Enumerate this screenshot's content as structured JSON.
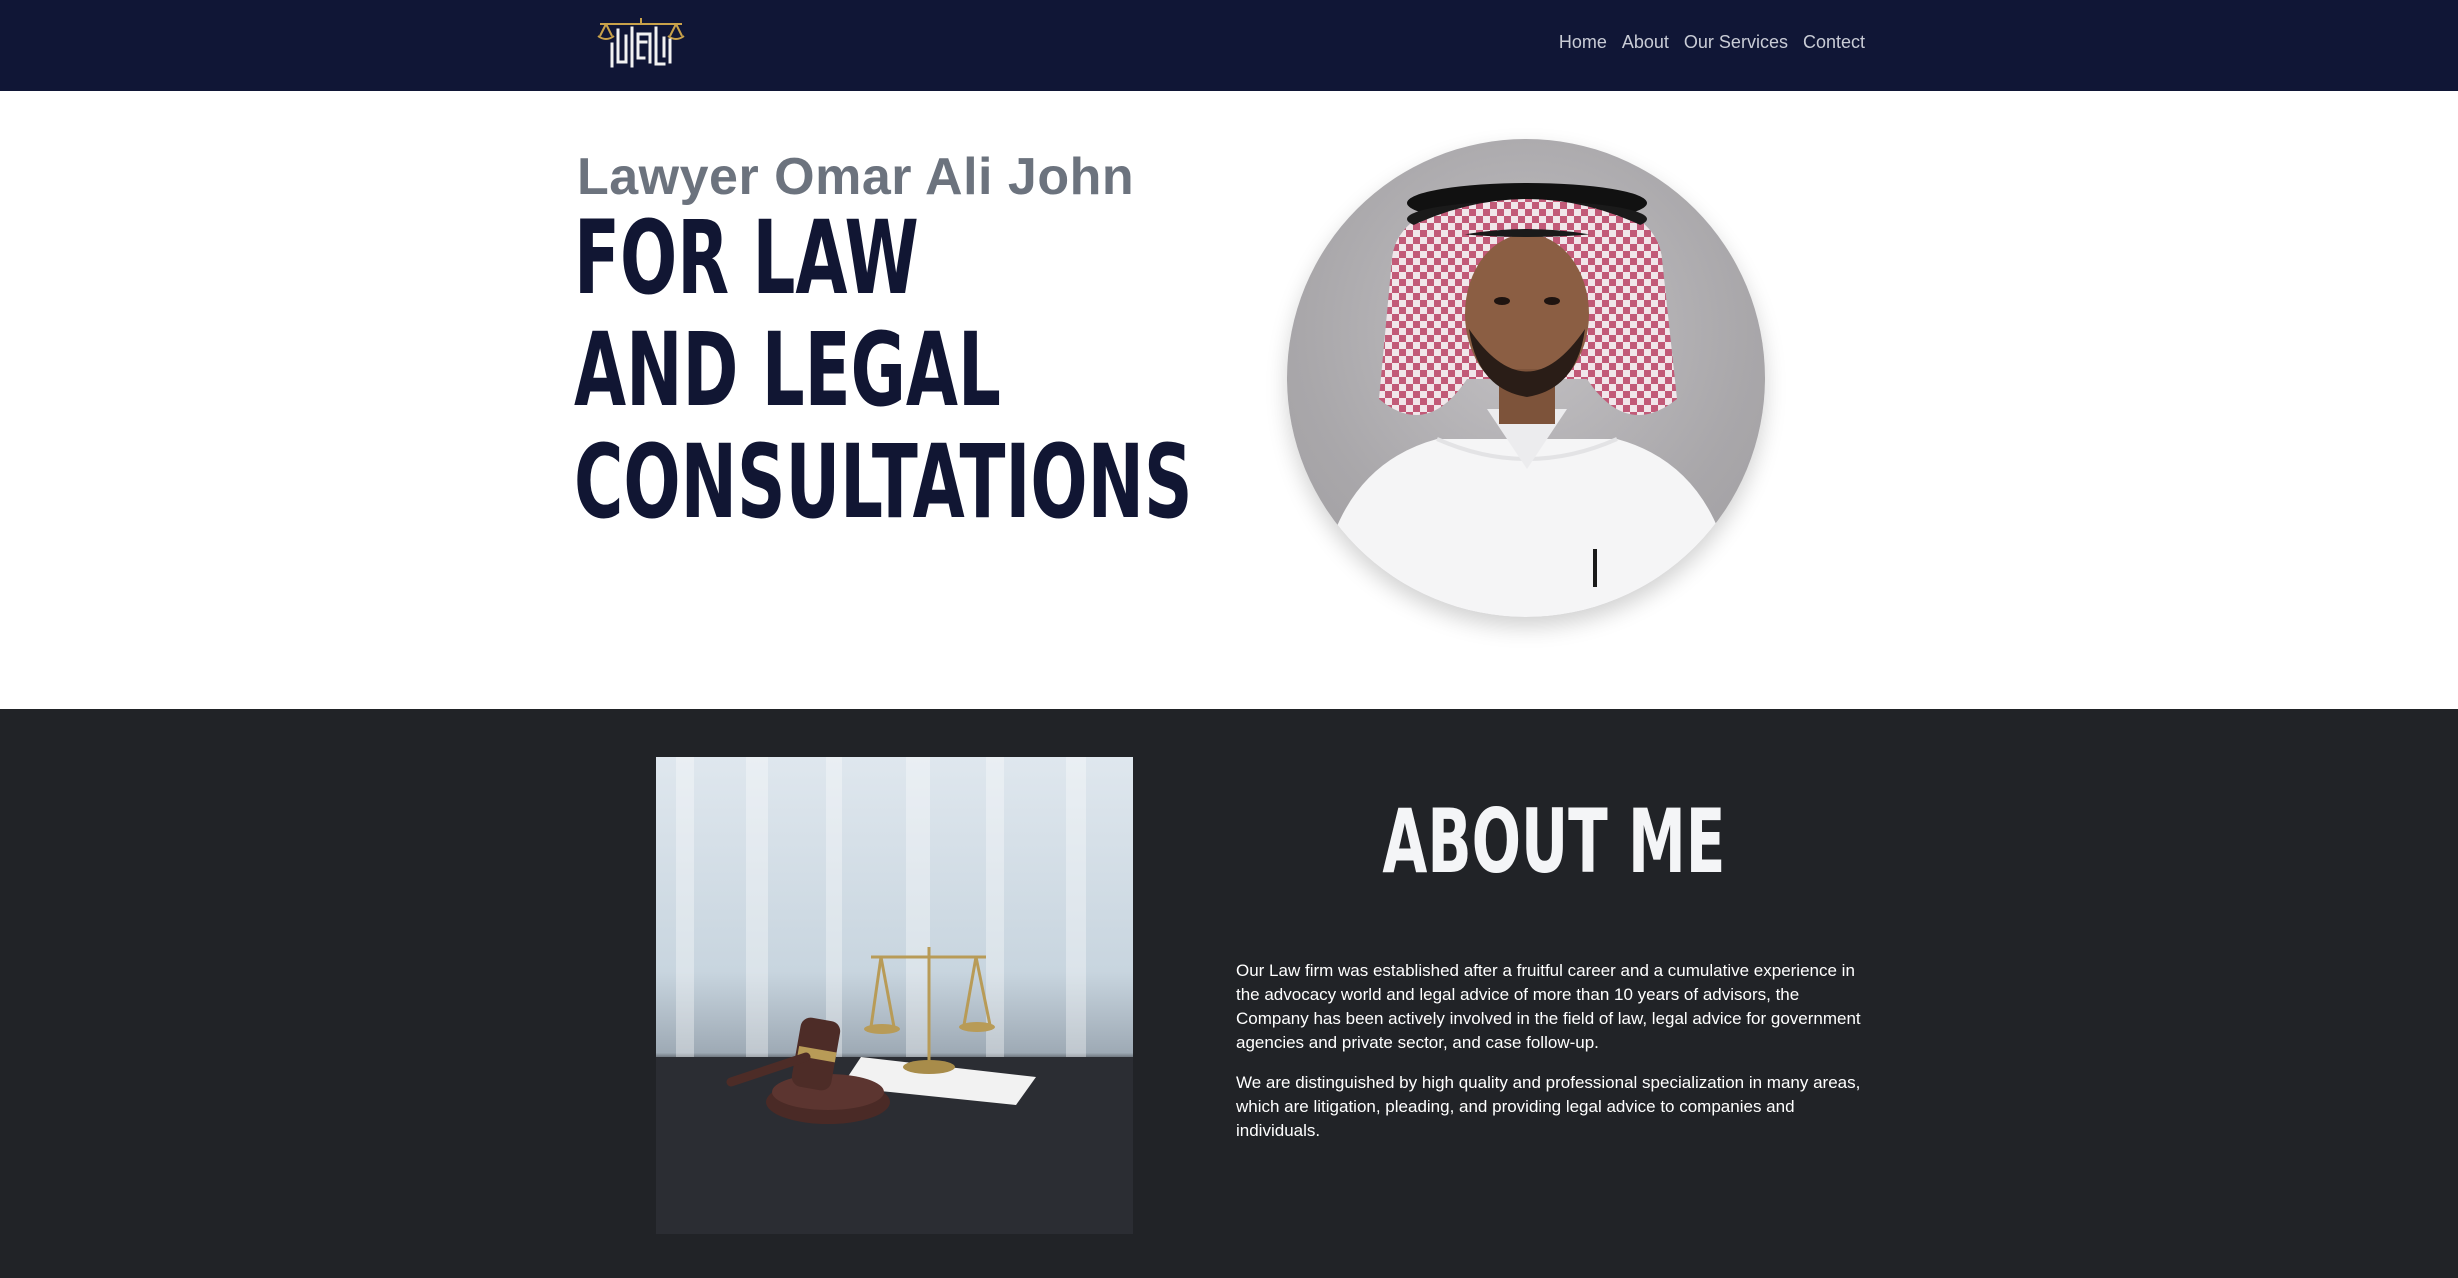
{
  "nav": {
    "logo_alt": "Law firm logo",
    "links": [
      "Home",
      "About",
      "Our Services",
      "Contect"
    ]
  },
  "hero": {
    "subtitle": "Lawyer Omar Ali John",
    "title_lines": [
      "FOR LAW",
      "AND LEGAL",
      "CONSULTATIONS"
    ]
  },
  "about": {
    "title": "ABOUT ME",
    "paragraphs": [
      "Our Law firm was established after a fruitful career and a cumulative experience in the advocacy world and legal advice of more than 10 years of advisors, the Company has been actively involved in the field of law, legal advice for government agencies and private sector, and case follow-up.",
      "We are distinguished by high quality and professional specialization in many areas, which are litigation, pleading, and providing legal advice to companies and individuals."
    ]
  },
  "colors": {
    "navbar_bg": "#101636",
    "hero_title": "#111633",
    "hero_subtitle": "#6c737e",
    "about_bg": "#212327",
    "accent_gold": "#c9a24a"
  },
  "icons": {
    "logo": "scales-of-justice-logo"
  }
}
